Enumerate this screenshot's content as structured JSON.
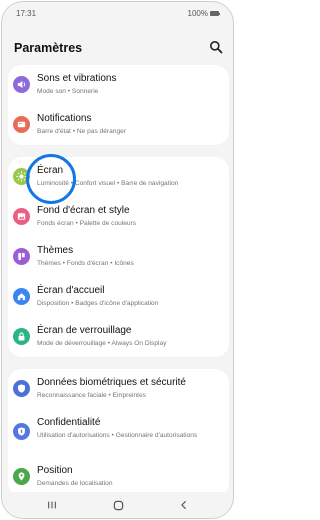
{
  "status": {
    "time": "17:31",
    "battery": "100%"
  },
  "header": {
    "title": "Paramètres"
  },
  "groups": [
    {
      "items": [
        {
          "title": "Sons et vibrations",
          "subtitle": "Mode son  •  Sonnerie",
          "icon": "speaker-icon",
          "color": "#8e6bd8"
        },
        {
          "title": "Notifications",
          "subtitle": "Barre d'état  •  Ne pas déranger",
          "icon": "bell-icon",
          "color": "#e66d58"
        }
      ]
    },
    {
      "items": [
        {
          "title": "Écran",
          "subtitle": "Luminosité  •  Confort visuel  •  Barre de navigation",
          "icon": "sun-icon",
          "color": "#9ac84a"
        },
        {
          "title": "Fond d'écran et style",
          "subtitle": "Fonds écran  •  Palette de couleurs",
          "icon": "image-icon",
          "color": "#e95f82"
        },
        {
          "title": "Thèmes",
          "subtitle": "Thèmes  •  Fonds d'écran  •  Icônes",
          "icon": "palette-icon",
          "color": "#9c5dd6"
        },
        {
          "title": "Écran d'accueil",
          "subtitle": "Disposition  •  Badges d'icône d'application",
          "icon": "home-icon",
          "color": "#3a85f0"
        },
        {
          "title": "Écran de verrouillage",
          "subtitle": "Mode de déverrouillage  •  Always On Display",
          "icon": "lock-icon",
          "color": "#2db38a"
        }
      ]
    },
    {
      "items": [
        {
          "title": "Données biométriques et sécurité",
          "subtitle": "Reconnaissance faciale  •  Empreintes",
          "icon": "shield-icon",
          "color": "#4e6fd8"
        },
        {
          "title": "Confidentialité",
          "subtitle": "Utilisation d'autorisations  •  Gestionnaire d'autorisations",
          "icon": "privacy-icon",
          "color": "#5478e0"
        },
        {
          "title": "Position",
          "subtitle": "Demandes de localisation",
          "icon": "location-pin-icon",
          "color": "#4aa94a"
        }
      ]
    }
  ]
}
